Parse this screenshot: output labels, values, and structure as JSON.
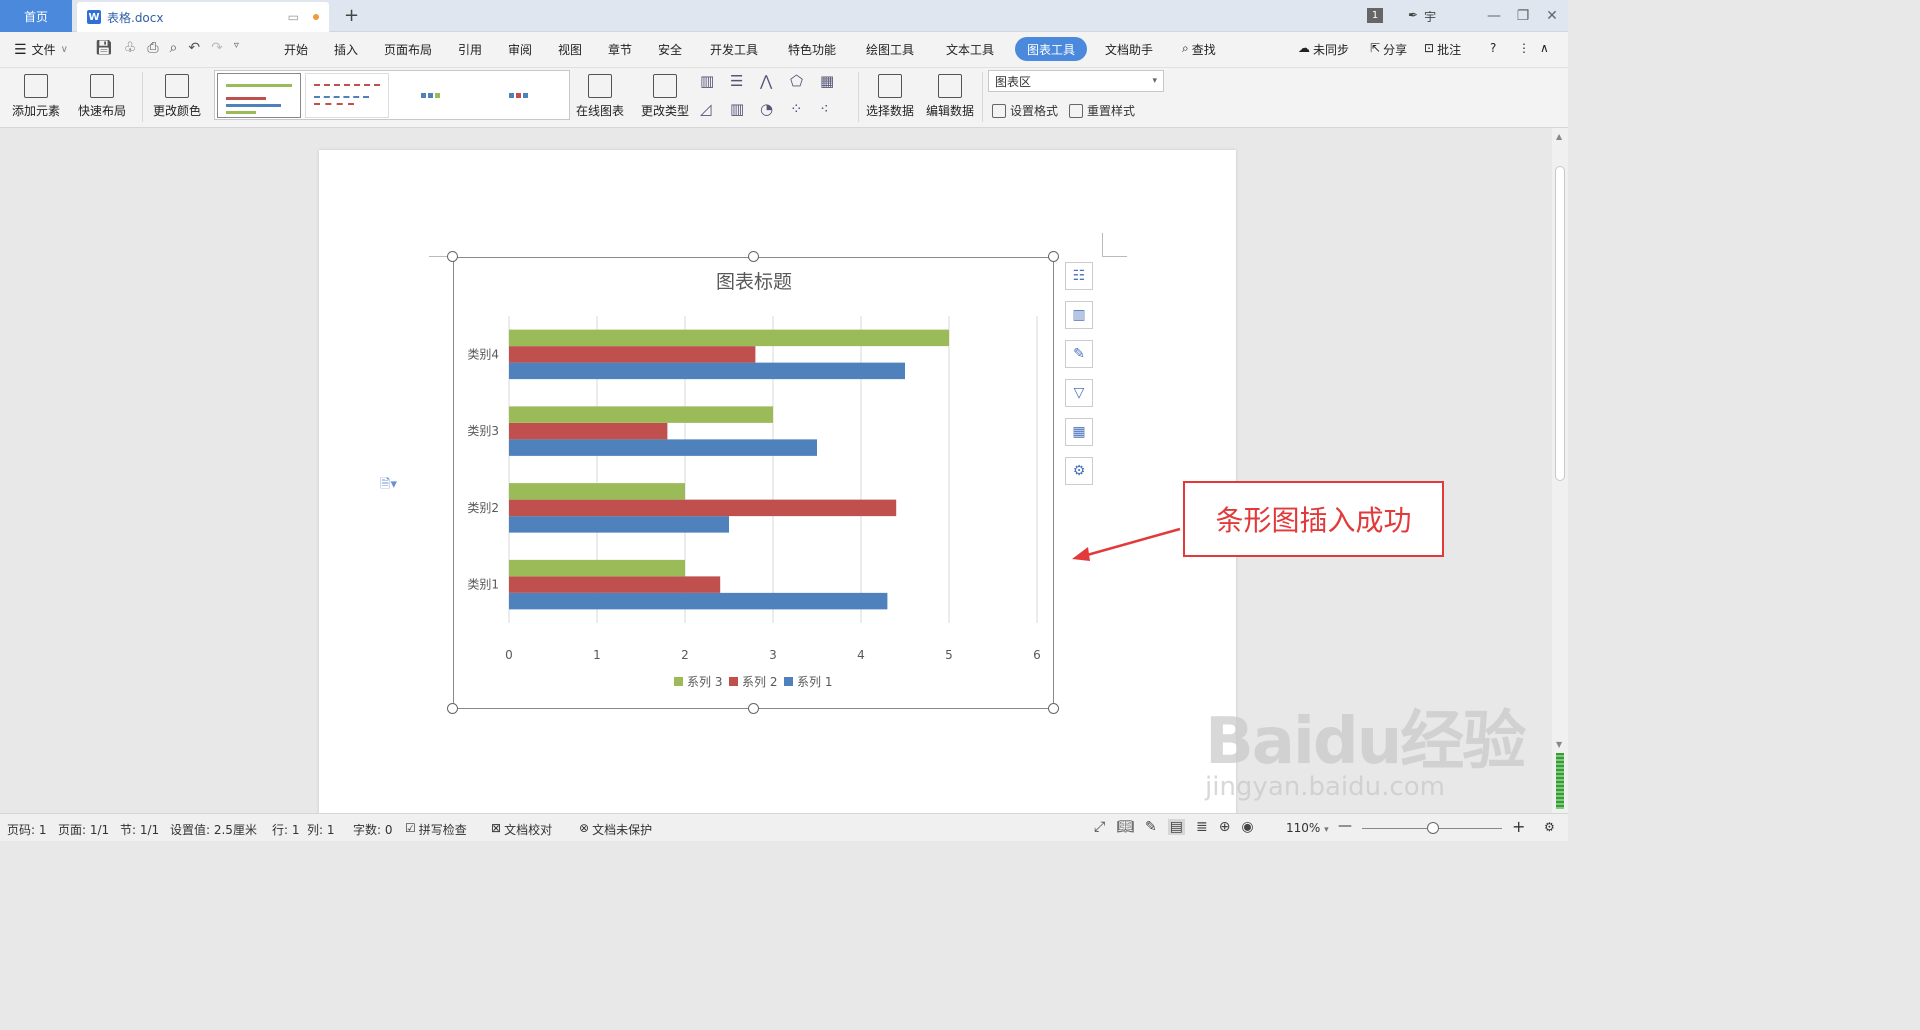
{
  "titlebar": {
    "home_tab": "首页",
    "doc_tab": "表格.docx",
    "new_tab": "+",
    "page_badge": "1",
    "user": "宇"
  },
  "menubar": {
    "file": "文件",
    "items": [
      "开始",
      "插入",
      "页面布局",
      "引用",
      "审阅",
      "视图",
      "章节",
      "安全",
      "开发工具",
      "特色功能",
      "绘图工具",
      "文本工具",
      "图表工具",
      "文档助手"
    ],
    "active": "图表工具",
    "search": "查找",
    "sync": "未同步",
    "share": "分享",
    "comment": "批注"
  },
  "ribbon": {
    "add_element": "添加元素",
    "quick_layout": "快速布局",
    "change_color": "更改颜色",
    "online_chart": "在线图表",
    "change_type": "更改类型",
    "select_data": "选择数据",
    "edit_data": "编辑数据",
    "area_select": "图表区",
    "set_format": "设置格式",
    "reset_style": "重置样式"
  },
  "chart_data": {
    "type": "bar",
    "orientation": "horizontal",
    "title": "图表标题",
    "categories": [
      "类别1",
      "类别2",
      "类别3",
      "类别4"
    ],
    "series": [
      {
        "name": "系列 1",
        "color": "#4f81bd",
        "values": [
          4.3,
          2.5,
          3.5,
          4.5
        ]
      },
      {
        "name": "系列 2",
        "color": "#c0504d",
        "values": [
          2.4,
          4.4,
          1.8,
          2.8
        ]
      },
      {
        "name": "系列 3",
        "color": "#9bbb59",
        "values": [
          2,
          2,
          3,
          5
        ]
      }
    ],
    "xticks": [
      "0",
      "1",
      "2",
      "3",
      "4",
      "5",
      "6"
    ],
    "xlim": [
      0,
      6
    ],
    "grid": true,
    "legend": "bottom"
  },
  "annotation": "条形图插入成功",
  "statusbar": {
    "page_no": "页码: 1",
    "pages": "页面: 1/1",
    "section": "节: 1/1",
    "setting": "设置值: 2.5厘米",
    "row": "行: 1",
    "col": "列: 1",
    "words": "字数: 0",
    "spell": "拼写检查",
    "proof": "文档校对",
    "protect": "文档未保护",
    "zoom": "110%"
  },
  "watermark": {
    "brand": "Baidu经验",
    "url": "jingyan.baidu.com"
  }
}
